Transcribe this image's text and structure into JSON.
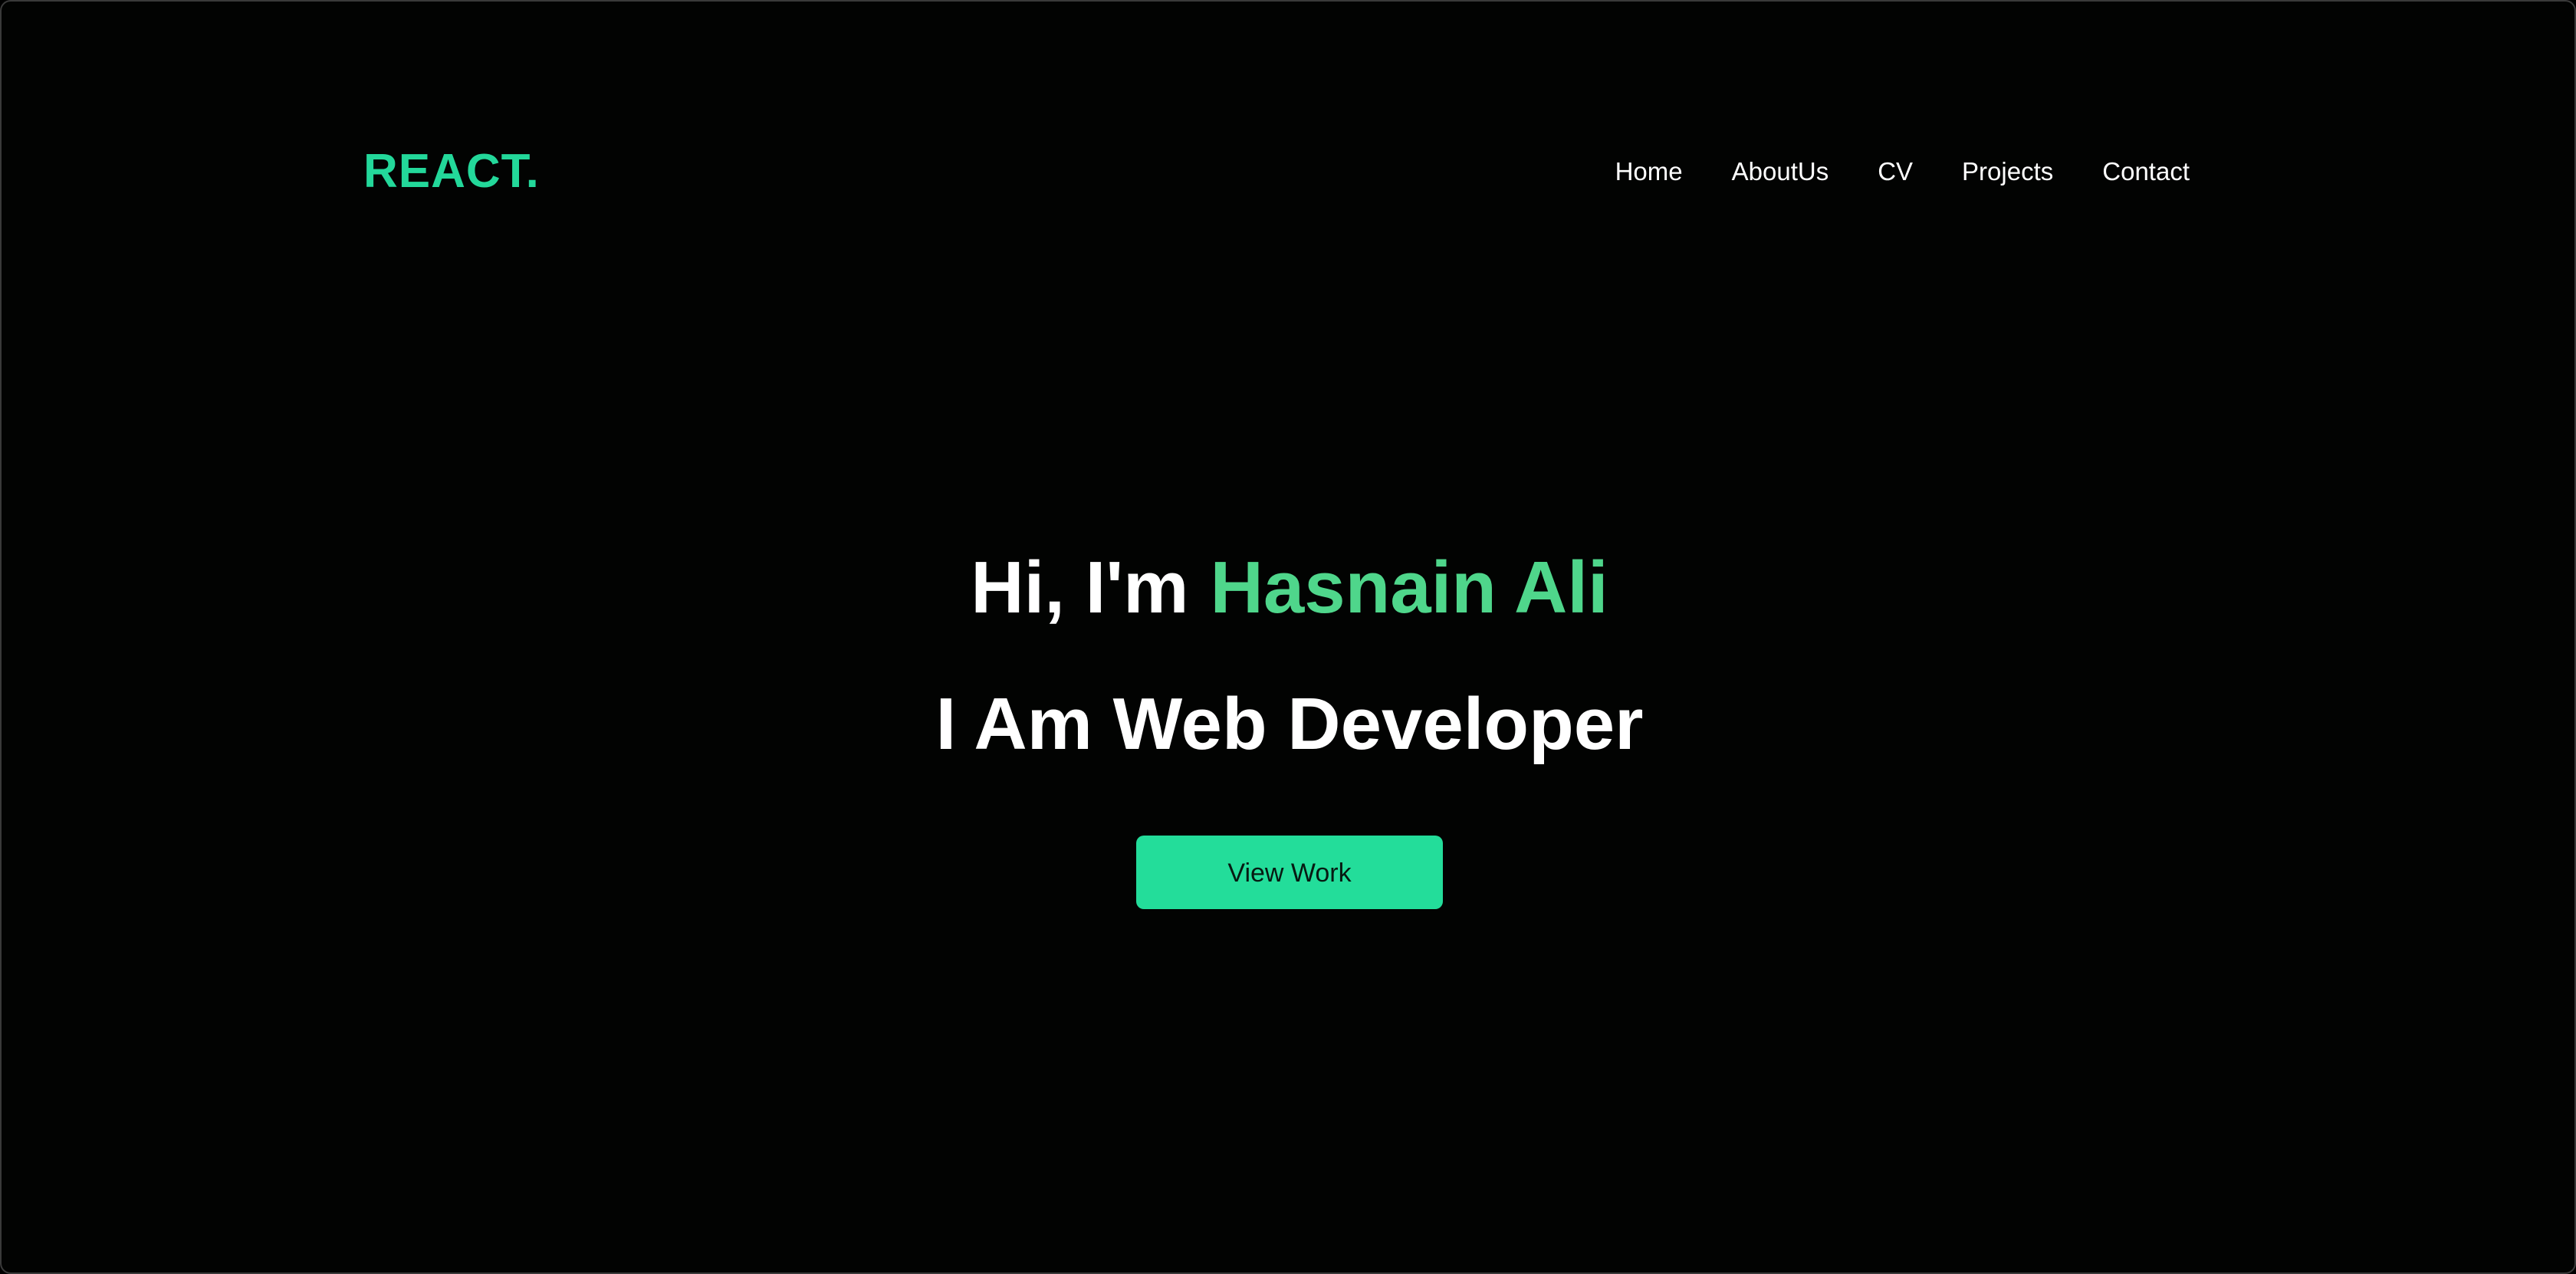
{
  "brand": {
    "logo": "REACT.",
    "accent_color": "#23d89a"
  },
  "nav": {
    "items": [
      {
        "label": "Home"
      },
      {
        "label": "AboutUs"
      },
      {
        "label": "CV"
      },
      {
        "label": "Projects"
      },
      {
        "label": "Contact"
      }
    ]
  },
  "hero": {
    "greeting_prefix": "Hi, I'm",
    "name": "Hasnain Ali",
    "name_color": "#4fd68b",
    "role": "I Am Web Developer",
    "cta_label": "View Work",
    "cta_color": "#23dd9a"
  }
}
